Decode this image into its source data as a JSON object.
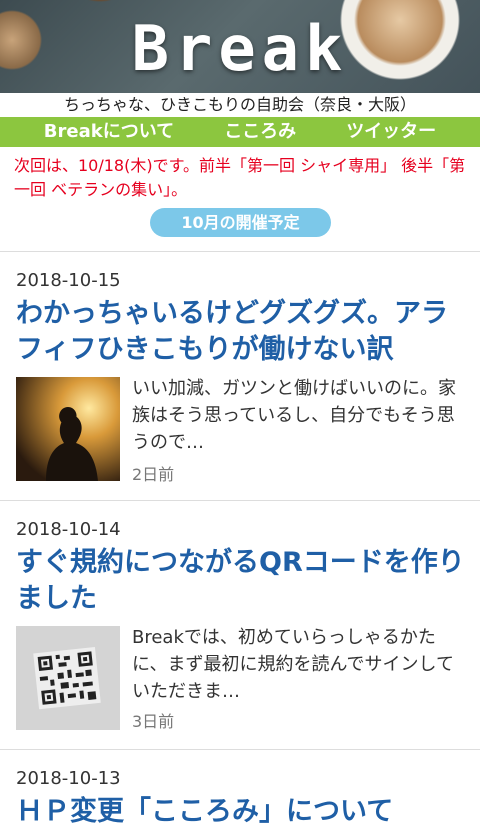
{
  "header": {
    "logo_text": "Break"
  },
  "tagline": "ちっちゃな、ひきこもりの自助会（奈良・大阪）",
  "nav": {
    "items": [
      {
        "label": "Breakについて"
      },
      {
        "label": "こころみ"
      },
      {
        "label": "ツイッター"
      }
    ]
  },
  "notice": "次回は、10/18(木)です。前半「第一回 シャイ専用」 後半「第一回 ベテランの集い」。",
  "schedule_button": "10月の開催予定",
  "articles": [
    {
      "date": "2018-10-15",
      "title": "わかっちゃいるけどグズグズ。アラフィフひきこもりが働けない訳",
      "excerpt": "いい加減、ガツンと働けばいいのに。家族はそう思っているし、自分でもそう思うので…",
      "ago": "2日前"
    },
    {
      "date": "2018-10-14",
      "title": "すぐ規約につながるQRコードを作りました",
      "excerpt": "Breakでは、初めていらっしゃるかたに、まず最初に規約を読んでサインしていただきま…",
      "ago": "3日前"
    },
    {
      "date": "2018-10-13",
      "title": "ＨＰ変更「こころみ」について"
    }
  ]
}
